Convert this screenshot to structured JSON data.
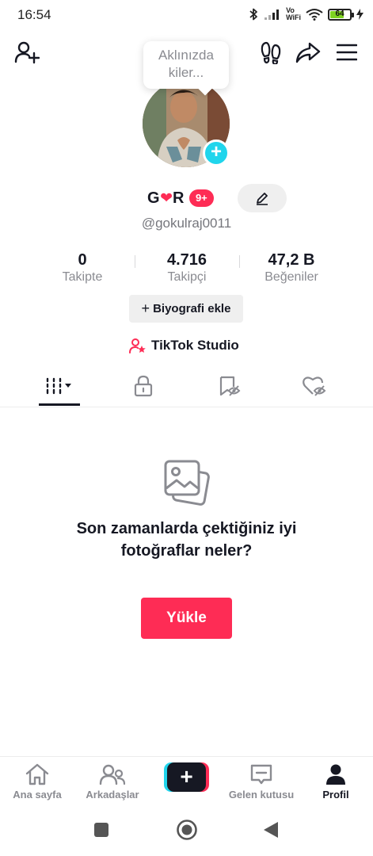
{
  "status_bar": {
    "time": "16:54",
    "volte_label": "Vo\nWiFi",
    "battery_level": "64",
    "battery_fraction": 0.64
  },
  "header": {
    "icons": [
      "add-person-icon",
      "footprints-icon",
      "share-arrow-icon",
      "hamburger-menu-icon"
    ]
  },
  "profile": {
    "note_placeholder": "Aklınızda kiler...",
    "display_name_prefix": "G",
    "display_name_heart": "❤",
    "display_name_suffix": "R",
    "notification_badge": "9+",
    "username": "@gokulraj0011",
    "stats": {
      "following": {
        "value": "0",
        "label": "Takipte"
      },
      "followers": {
        "value": "4.716",
        "label": "Takipçi"
      },
      "likes": {
        "value": "47,2 B",
        "label": "Beğeniler"
      }
    },
    "bio_button_plus": "+",
    "bio_button_label": "Biyografi ekle",
    "studio_link": "TikTok Studio"
  },
  "tabs": {
    "items": [
      "grid-icon",
      "lock-icon",
      "bookmark-eye-icon",
      "heart-eye-icon"
    ],
    "active": 0
  },
  "empty_state": {
    "message": "Son zamanlarda çektiğiniz iyi fotoğraflar neler?",
    "upload_button": "Yükle"
  },
  "bottom_nav": {
    "home": "Ana sayfa",
    "friends": "Arkadaşlar",
    "create": "+",
    "inbox": "Gelen kutusu",
    "profile": "Profil",
    "active": "profile"
  },
  "colors": {
    "accent": "#fe2c55",
    "cyan": "#20d5ec",
    "text": "#161823",
    "muted": "#8a8b91"
  }
}
